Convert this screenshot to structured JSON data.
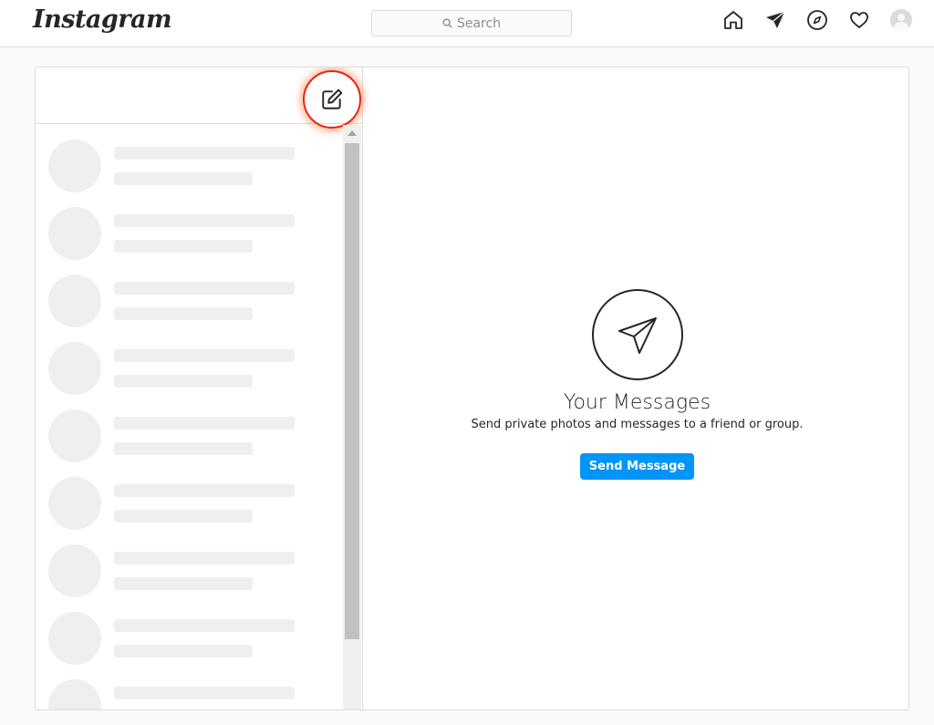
{
  "header": {
    "logo_text": "Instagram",
    "search_placeholder": "Search",
    "icons": [
      "home-icon",
      "direct-icon",
      "explore-icon",
      "activity-heart-icon",
      "profile-avatar"
    ]
  },
  "inbox": {
    "compose_icon": "new-message-icon",
    "skeleton_rows": 8
  },
  "empty_state": {
    "icon": "paper-plane-icon",
    "title": "Your Messages",
    "subtitle": "Send private photos and messages to a friend or group.",
    "button_label": "Send Message"
  },
  "colors": {
    "accent": "#0095f6",
    "highlight_ring": "#e8220f",
    "border": "#dbdbdb",
    "skeleton": "#efefef"
  }
}
